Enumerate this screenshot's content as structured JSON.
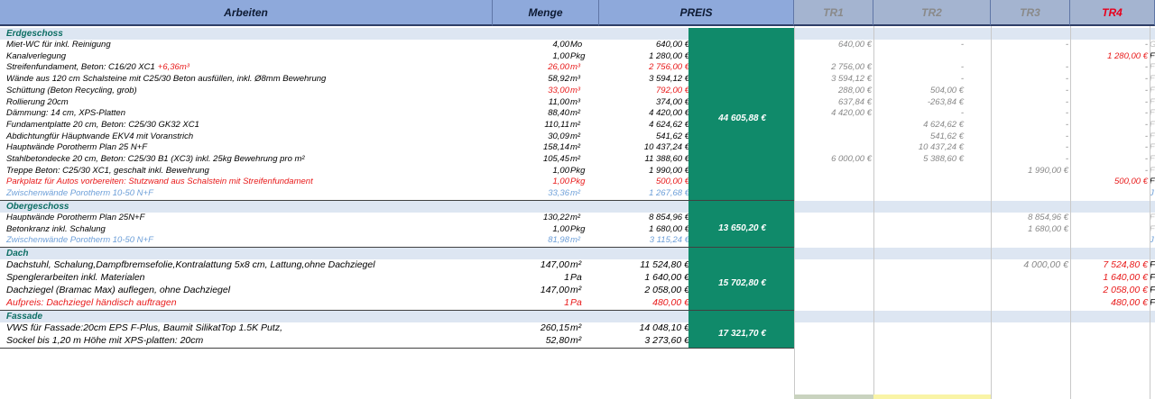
{
  "header": {
    "arbeiten": "Arbeiten",
    "menge": "Menge",
    "preis": "PREIS",
    "tr1": "TR1",
    "tr2": "TR2",
    "tr3": "TR3",
    "tr4": "TR4"
  },
  "sections": {
    "erdgeschoss": {
      "title": "Erdgeschoss",
      "total": "44 605,88 €",
      "rows": [
        {
          "name": "Miet-WC für inkl. Reinigung",
          "qty": "4,00",
          "unit": "Mo",
          "price": "640,00 €",
          "tr1": "640,00 €",
          "tr2": "-",
          "tr3": "-",
          "tr4": "-",
          "extra": "G"
        },
        {
          "name": "Kanalverlegung",
          "qty": "1,00",
          "unit": "Pkg",
          "price": "1 280,00 €",
          "tr1": "",
          "tr2": "",
          "tr3": "",
          "tr4": "1 280,00 €",
          "extra": "F"
        },
        {
          "name": "Streifenfundament, Beton: C16/20 XC1",
          "name_extra": "+6,36m³",
          "qty": "26,00",
          "unit": "m³",
          "price": "2 756,00 €",
          "tr1": "2 756,00 €",
          "tr2": "-",
          "tr3": "-",
          "tr4": "-",
          "extra": "F"
        },
        {
          "name": "Wände aus 120 cm Schalsteine mit C25/30 Beton ausfüllen, inkl. Ø8mm Bewehrung",
          "qty": "58,92",
          "unit": "m³",
          "price": "3 594,12 €",
          "tr1": "3 594,12 €",
          "tr2": "-",
          "tr3": "-",
          "tr4": "-",
          "extra": "F"
        },
        {
          "name": "Schüttung (Beton Recycling, grob)",
          "qty": "33,00",
          "unit": "m³",
          "price": "792,00 €",
          "tr1": "288,00 €",
          "tr2": "504,00 €",
          "tr3": "-",
          "tr4": "-",
          "extra": "F"
        },
        {
          "name": "Rollierung 20cm",
          "qty": "11,00",
          "unit": "m³",
          "price": "374,00 €",
          "tr1": "637,84 €",
          "tr2": "-263,84 €",
          "tr3": "-",
          "tr4": "-",
          "extra": "F"
        },
        {
          "name": "Dämmung: 14 cm, XPS-Platten",
          "qty": "88,40",
          "unit": "m²",
          "price": "4 420,00 €",
          "tr1": "4 420,00 €",
          "tr2": "-",
          "tr3": "-",
          "tr4": "-",
          "extra": "F"
        },
        {
          "name": "Fundamentplatte 20 cm, Beton: C25/30 GK32 XC1",
          "qty": "110,11",
          "unit": "m²",
          "price": "4 624,62 €",
          "tr1": "",
          "tr2": "4 624,62 €",
          "tr3": "-",
          "tr4": "-",
          "extra": "F"
        },
        {
          "name": "Abdichtungfür Häuptwande EKV4 mit Voranstrich",
          "qty": "30,09",
          "unit": "m²",
          "price": "541,62 €",
          "tr1": "",
          "tr2": "541,62 €",
          "tr3": "-",
          "tr4": "-",
          "extra": "F"
        },
        {
          "name": "Hauptwände Porotherm Plan 25 N+F",
          "qty": "158,14",
          "unit": "m²",
          "price": "10 437,24 €",
          "tr1": "",
          "tr2": "10 437,24 €",
          "tr3": "-",
          "tr4": "-",
          "extra": "F"
        },
        {
          "name": "Stahlbetondecke 20 cm, Beton: C25/30 B1 (XC3) inkl. 25kg Bewehrung pro m²",
          "qty": "105,45",
          "unit": "m²",
          "price": "11 388,60 €",
          "tr1": "6 000,00 €",
          "tr2": "5 388,60 €",
          "tr3": "-",
          "tr4": "-",
          "extra": "F"
        },
        {
          "name": "Treppe Beton: C25/30 XC1, geschalt inkl. Bewehrung",
          "qty": "1,00",
          "unit": "Pkg",
          "price": "1 990,00 €",
          "tr1": "",
          "tr2": "",
          "tr3": "1 990,00 €",
          "tr4": "-",
          "extra": "F"
        },
        {
          "name": "Parkplatz für Autos vorbereiten: Stutzwand aus Schalstein mit Streifenfundament",
          "qty": "1,00",
          "unit": "Pkg",
          "price": "500,00 €",
          "tr1": "",
          "tr2": "",
          "tr3": "",
          "tr4": "500,00 €",
          "extra": "F"
        },
        {
          "name": "Zwischenwände Porotherm 10-50 N+F",
          "qty": "33,36",
          "unit": "m²",
          "price": "1 267,68 €",
          "tr1": "",
          "tr2": "",
          "tr3": "",
          "tr4": "",
          "extra": "J"
        }
      ]
    },
    "obergeschoss": {
      "title": "Obergeschoss",
      "total": "13 650,20 €",
      "rows": [
        {
          "name": "Hauptwände Porotherm Plan 25N+F",
          "qty": "130,22",
          "unit": "m²",
          "price": "8 854,96 €",
          "tr1": "",
          "tr2": "",
          "tr3": "8 854,96 €",
          "tr4": "",
          "extra": "F"
        },
        {
          "name": "Betonkranz inkl. Schalung",
          "qty": "1,00",
          "unit": "Pkg",
          "price": "1 680,00 €",
          "tr1": "",
          "tr2": "",
          "tr3": "1 680,00 €",
          "tr4": "",
          "extra": "F"
        },
        {
          "name": "Zwischenwände Porotherm 10-50 N+F",
          "qty": "81,98",
          "unit": "m²",
          "price": "3 115,24 €",
          "tr1": "",
          "tr2": "",
          "tr3": "",
          "tr4": "",
          "extra": "J"
        }
      ]
    },
    "dach": {
      "title": "Dach",
      "total": "15 702,80 €",
      "rows": [
        {
          "name": " Dachstuhl, Schalung,Dampfbremsefolie,Kontralattung 5x8 cm, Lattung,ohne Dachziegel",
          "qty": "147,00",
          "unit": "m²",
          "price": "11 524,80 €",
          "tr1": "",
          "tr2": "",
          "tr3": "4 000,00 €",
          "tr4": "7 524,80 €",
          "extra": "F"
        },
        {
          "name": "Spenglerarbeiten inkl. Materialen",
          "qty": "1",
          "unit": "Pa",
          "price": "1 640,00 €",
          "tr1": "",
          "tr2": "",
          "tr3": "",
          "tr4": "1 640,00 €",
          "extra": "F"
        },
        {
          "name": "Dachziegel (Bramac Max) auflegen, ohne Dachziegel",
          "qty": "147,00",
          "unit": "m²",
          "price": "2 058,00 €",
          "tr1": "",
          "tr2": "",
          "tr3": "",
          "tr4": "2 058,00 €",
          "extra": "F"
        },
        {
          "name": "Aufpreis: Dachziegel händisch auftragen",
          "qty": "1",
          "unit": "Pa",
          "price": "480,00 €",
          "tr1": "",
          "tr2": "",
          "tr3": "",
          "tr4": "480,00 €",
          "extra": "F"
        }
      ]
    },
    "fassade": {
      "title": "Fassade",
      "total": "17 321,70 €",
      "rows": [
        {
          "name": "VWS für Fassade:20cm EPS F-Plus, Baumit SilikatTop 1.5K Putz,",
          "qty": "260,15",
          "unit": "m²",
          "price": "14 048,10 €",
          "tr1": "",
          "tr2": "",
          "tr3": "",
          "tr4": "",
          "extra": ""
        },
        {
          "name": "Sockel bis 1,20 m Höhe mit XPS-platten:  20cm",
          "qty": "52,80",
          "unit": "m²",
          "price": "3 273,60 €",
          "tr1": "",
          "tr2": "",
          "tr3": "",
          "tr4": "",
          "extra": ""
        }
      ]
    }
  },
  "colors": {
    "header_blue": "#8ea9db",
    "section_band": "#dde6f2",
    "total_green": "#108a6a",
    "section_title": "#0c6e64",
    "red_text": "#e81a1a",
    "blue_text": "#6d9fd8"
  }
}
